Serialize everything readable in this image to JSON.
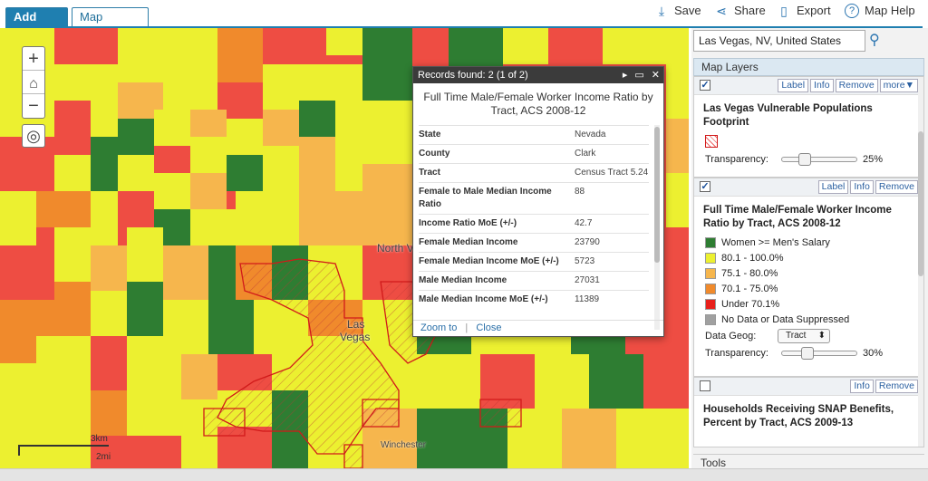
{
  "tabs": [
    {
      "label": "Add Data"
    },
    {
      "label": "Map Gallery"
    }
  ],
  "toolbar": {
    "save": "Save",
    "share": "Share",
    "export": "Export",
    "help": "Map Help"
  },
  "map": {
    "labels": {
      "north_vegas": "North Vega",
      "las_vegas_1": "Las",
      "las_vegas_2": "Vegas",
      "winchester": "Winchester"
    },
    "scale": {
      "km": "3km",
      "mi": "2mi"
    },
    "zoom_in": "+",
    "zoom_out": "−"
  },
  "popup": {
    "header": "Records found: 2 (1 of 2)",
    "title": "Full Time Male/Female Worker Income Ratio by Tract, ACS 2008-12",
    "rows": [
      {
        "key": "State",
        "value": "Nevada"
      },
      {
        "key": "County",
        "value": "Clark"
      },
      {
        "key": "Tract",
        "value": "Census Tract 5.24"
      },
      {
        "key": "Female to Male Median Income Ratio",
        "value": "88"
      },
      {
        "key": "Income Ratio MoE (+/-)",
        "value": "42.7"
      },
      {
        "key": "Female Median Income",
        "value": "23790"
      },
      {
        "key": "Female Median Income MoE (+/-)",
        "value": "5723"
      },
      {
        "key": "Male Median Income",
        "value": "27031"
      },
      {
        "key": "Male Median Income MoE (+/-)",
        "value": "11389"
      }
    ],
    "zoom_to": "Zoom to",
    "close": "Close"
  },
  "search": {
    "value": "Las Vegas, NV, United States"
  },
  "layers": {
    "header": "Map Layers",
    "layer1": {
      "title": "Las Vegas Vulnerable Populations Footprint",
      "btn_label": "Label",
      "btn_info": "Info",
      "btn_remove": "Remove",
      "btn_more": "more▼",
      "transparency_label": "Transparency:",
      "transparency_value": "25%",
      "transparency_fraction": 0.25
    },
    "layer2": {
      "title": "Full Time Male/Female Worker Income Ratio by Tract, ACS 2008-12",
      "btn_label": "Label",
      "btn_info": "Info",
      "btn_remove": "Remove",
      "legend": [
        {
          "label": "Women >= Men's Salary",
          "color": "#2e7d32"
        },
        {
          "label": "80.1 - 100.0%",
          "color": "#ecf030"
        },
        {
          "label": "75.1 - 80.0%",
          "color": "#f6b64d"
        },
        {
          "label": "70.1 - 75.0%",
          "color": "#f08a2c"
        },
        {
          "label": "Under 70.1%",
          "color": "#e8201b"
        },
        {
          "label": "No Data or Data Suppressed",
          "color": "#a0a0a0"
        }
      ],
      "geog_label": "Data Geog:",
      "geog_value": "Tract",
      "transparency_label": "Transparency:",
      "transparency_value": "30%",
      "transparency_fraction": 0.3
    },
    "layer3": {
      "title": "Households Receiving SNAP Benefits, Percent by Tract, ACS 2009-13",
      "btn_info": "Info",
      "btn_remove": "Remove"
    },
    "tools": "Tools"
  },
  "colors": {
    "accent": "#1f7fb0",
    "green": "#2e7d32",
    "yellow": "#ecf030",
    "light_orange": "#f6b64d",
    "orange": "#f08a2c",
    "red": "#ee4d43"
  }
}
